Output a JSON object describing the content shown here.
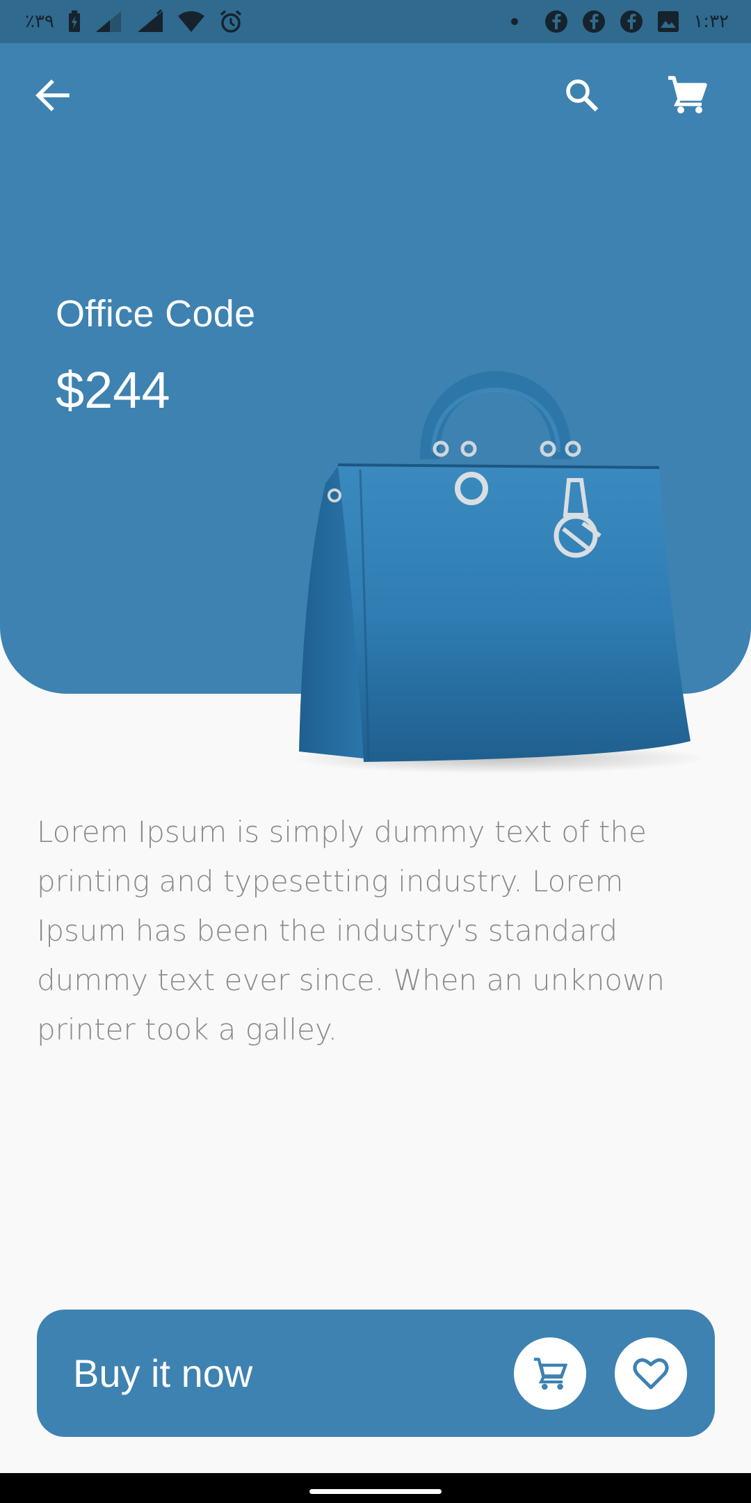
{
  "status_bar": {
    "battery_percent": "٪۳۹",
    "time": "۱:۳۲",
    "icons_left": [
      "battery-charging-icon",
      "signal-icon",
      "signal-icon",
      "wifi-icon",
      "alarm-icon"
    ],
    "icons_right": [
      "notification-dot-icon",
      "facebook-icon",
      "facebook-icon",
      "facebook-icon",
      "image-icon"
    ]
  },
  "appbar": {
    "back_icon": "arrow-back-icon",
    "search_icon": "search-icon",
    "cart_icon": "cart-icon"
  },
  "product": {
    "title": "Office Code",
    "price": "$244",
    "image": "blue-handbag",
    "description": "Lorem Ipsum is simply dummy text of the printing and typesetting industry. Lorem Ipsum has been the industry's standard dummy text ever since. When an unknown printer took a galley."
  },
  "buy_bar": {
    "label": "Buy it now",
    "cart_icon": "cart-icon",
    "favorite_icon": "heart-icon"
  },
  "colors": {
    "primary": "#3d82b1",
    "status_bar": "#306a8e",
    "background": "#f9f9fa",
    "description_text": "#8a8a8a"
  }
}
